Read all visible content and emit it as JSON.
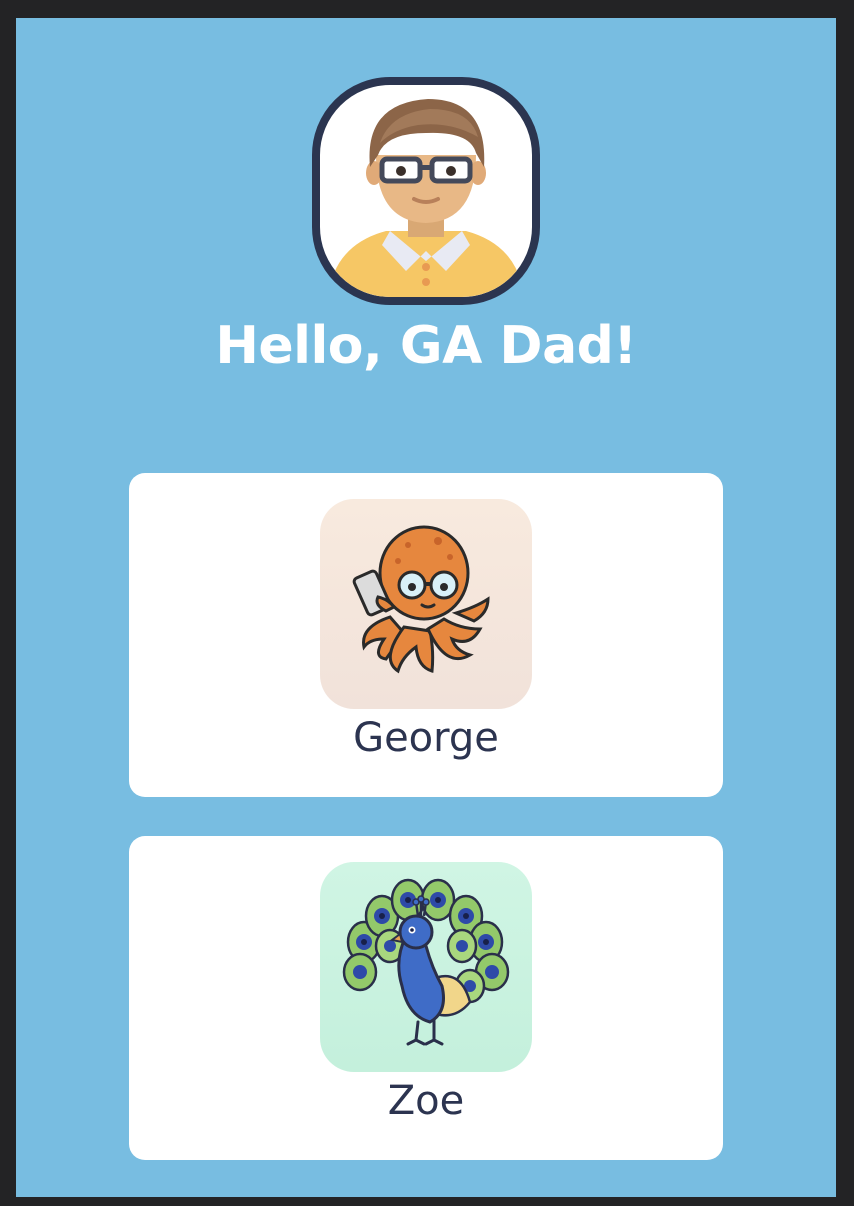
{
  "profile": {
    "greeting": "Hello, GA Dad!",
    "avatar_icon": "dad-avatar-icon"
  },
  "children": [
    {
      "name": "George",
      "avatar_icon": "octopus-avatar-icon",
      "tile_color": "#f5e7de"
    },
    {
      "name": "Zoe",
      "avatar_icon": "peacock-avatar-icon",
      "tile_color": "#ccf3e1"
    }
  ],
  "colors": {
    "background": "#78bde1",
    "card": "#ffffff",
    "ring": "#2b3550",
    "text_dark": "#2c3450",
    "text_light": "#ffffff"
  }
}
